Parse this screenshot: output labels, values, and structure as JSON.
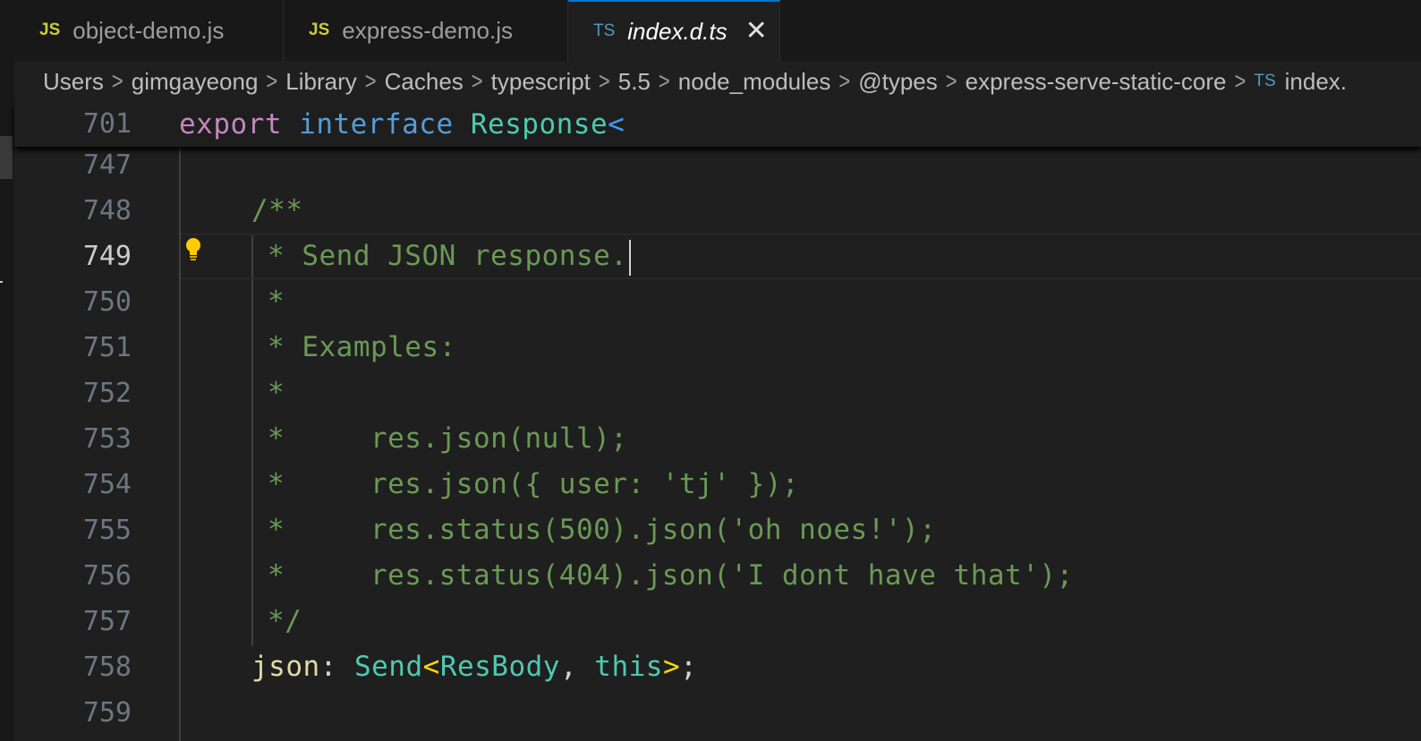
{
  "tabs": [
    {
      "lang": "JS",
      "name": "object-demo.js",
      "active": false
    },
    {
      "lang": "JS",
      "name": "express-demo.js",
      "active": false
    },
    {
      "lang": "TS",
      "name": "index.d.ts",
      "active": true,
      "close": "✕"
    }
  ],
  "breadcrumb": {
    "items": [
      "Users",
      "gimgayeong",
      "Library",
      "Caches",
      "typescript",
      "5.5",
      "node_modules",
      "@types",
      "express-serve-static-core"
    ],
    "file_lang": "TS",
    "file": "index."
  },
  "sticky": {
    "line_number": "701",
    "tokens": {
      "export": "export",
      "interface": "interface",
      "name": "Response",
      "angle": "<"
    }
  },
  "editor": {
    "current_line": "749",
    "lines": [
      {
        "n": "747",
        "text": ""
      },
      {
        "n": "748",
        "text": "/**"
      },
      {
        "n": "749",
        "text": "* Send JSON response."
      },
      {
        "n": "750",
        "text": "*"
      },
      {
        "n": "751",
        "text": "* Examples:"
      },
      {
        "n": "752",
        "text": "*"
      },
      {
        "n": "753",
        "text": "*     res.json(null);"
      },
      {
        "n": "754",
        "text": "*     res.json({ user: 'tj' });"
      },
      {
        "n": "755",
        "text": "*     res.status(500).json('oh noes!');"
      },
      {
        "n": "756",
        "text": "*     res.status(404).json('I dont have that');"
      },
      {
        "n": "757",
        "text": "*/"
      },
      {
        "n": "758",
        "text": ""
      },
      {
        "n": "759",
        "text": ""
      }
    ],
    "line758": {
      "prop": "json",
      "colon": ": ",
      "type": "Send",
      "lt": "<",
      "arg1": "ResBody",
      "comma": ", ",
      "arg2": "this",
      "gt": ">",
      "semi": ";"
    }
  },
  "colors": {
    "keyword_pink": "#c586c0",
    "keyword_blue": "#569cd6",
    "type_teal": "#4ec9b0",
    "comment_green": "#6a9955",
    "tab_accent": "#0078d4"
  }
}
